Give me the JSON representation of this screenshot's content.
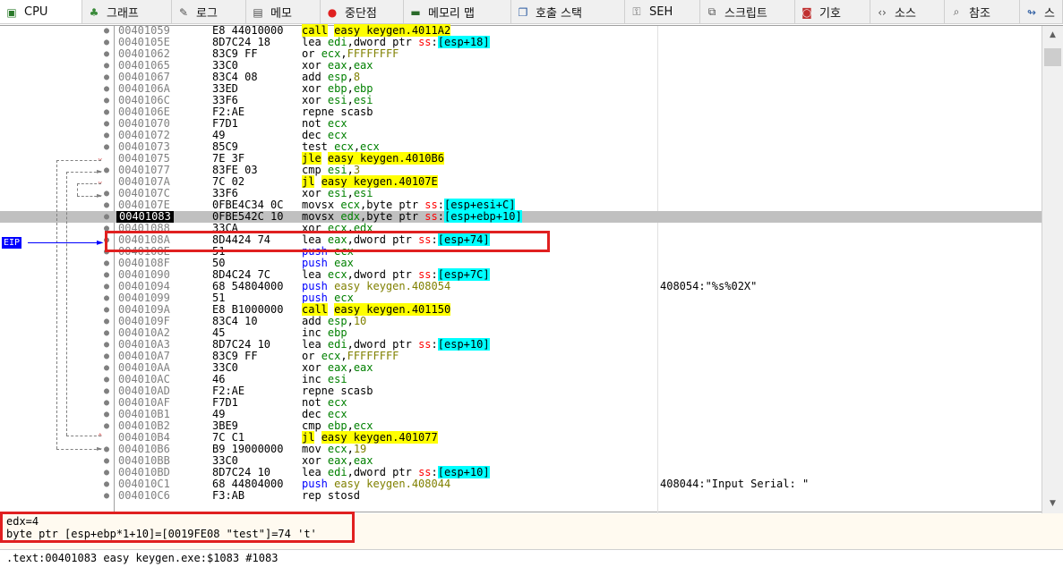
{
  "tabs": [
    {
      "label": "CPU",
      "icon": "cpu-icon",
      "active": true
    },
    {
      "label": "그래프",
      "icon": "graph-icon"
    },
    {
      "label": "로그",
      "icon": "log-icon"
    },
    {
      "label": "메모",
      "icon": "notes-icon"
    },
    {
      "label": "중단점",
      "icon": "breakpoint-icon"
    },
    {
      "label": "메모리 맵",
      "icon": "memory-map-icon"
    },
    {
      "label": "호출 스택",
      "icon": "call-stack-icon"
    },
    {
      "label": "SEH",
      "icon": "seh-icon"
    },
    {
      "label": "스크립트",
      "icon": "script-icon"
    },
    {
      "label": "기호",
      "icon": "symbols-icon"
    },
    {
      "label": "소스",
      "icon": "source-icon"
    },
    {
      "label": "참조",
      "icon": "references-icon"
    },
    {
      "label": "스",
      "icon": "threads-icon"
    }
  ],
  "eip_label": "EIP",
  "colors": {
    "highlight_box": "#e02020",
    "yellow": "#ffff00",
    "cyan": "#00ffff",
    "register": "#008000",
    "segment": "#ff0000"
  },
  "rows": [
    {
      "addr": "00401059",
      "bytes": "E8 44010000",
      "asm": [
        [
          "call",
          "call"
        ],
        [
          "def",
          " "
        ],
        [
          "call",
          "easy keygen.4011A2"
        ]
      ]
    },
    {
      "addr": "0040105E",
      "bytes": "8D7C24 18",
      "asm": [
        [
          "def",
          "lea "
        ],
        [
          "reg",
          "edi"
        ],
        [
          "def",
          ",dword ptr "
        ],
        [
          "seg",
          "ss"
        ],
        [
          "def",
          ":"
        ],
        [
          "mem",
          "[esp+18]"
        ]
      ]
    },
    {
      "addr": "00401062",
      "bytes": "83C9 FF",
      "asm": [
        [
          "def",
          "or "
        ],
        [
          "reg",
          "ecx"
        ],
        [
          "def",
          ","
        ],
        [
          "sym",
          "FFFFFFFF"
        ]
      ]
    },
    {
      "addr": "00401065",
      "bytes": "33C0",
      "asm": [
        [
          "def",
          "xor "
        ],
        [
          "reg",
          "eax"
        ],
        [
          "def",
          ","
        ],
        [
          "reg",
          "eax"
        ]
      ]
    },
    {
      "addr": "00401067",
      "bytes": "83C4 08",
      "asm": [
        [
          "def",
          "add "
        ],
        [
          "reg",
          "esp"
        ],
        [
          "def",
          ","
        ],
        [
          "sym",
          "8"
        ]
      ]
    },
    {
      "addr": "0040106A",
      "bytes": "33ED",
      "asm": [
        [
          "def",
          "xor "
        ],
        [
          "reg",
          "ebp"
        ],
        [
          "def",
          ","
        ],
        [
          "reg",
          "ebp"
        ]
      ]
    },
    {
      "addr": "0040106C",
      "bytes": "33F6",
      "asm": [
        [
          "def",
          "xor "
        ],
        [
          "reg",
          "esi"
        ],
        [
          "def",
          ","
        ],
        [
          "reg",
          "esi"
        ]
      ]
    },
    {
      "addr": "0040106E",
      "bytes": "F2:AE",
      "asm": [
        [
          "def",
          "repne scasb"
        ]
      ]
    },
    {
      "addr": "00401070",
      "bytes": "F7D1",
      "asm": [
        [
          "def",
          "not "
        ],
        [
          "reg",
          "ecx"
        ]
      ]
    },
    {
      "addr": "00401072",
      "bytes": "49",
      "asm": [
        [
          "def",
          "dec "
        ],
        [
          "reg",
          "ecx"
        ]
      ]
    },
    {
      "addr": "00401073",
      "bytes": "85C9",
      "asm": [
        [
          "def",
          "test "
        ],
        [
          "reg",
          "ecx"
        ],
        [
          "def",
          ","
        ],
        [
          "reg",
          "ecx"
        ]
      ]
    },
    {
      "addr": "00401075",
      "bytes": "7E 3F",
      "mark": "dn",
      "asm": [
        [
          "call",
          "jle"
        ],
        [
          "def",
          " "
        ],
        [
          "call",
          "easy keygen.4010B6"
        ]
      ]
    },
    {
      "addr": "00401077",
      "bytes": "83FE 03",
      "asm": [
        [
          "def",
          "cmp "
        ],
        [
          "reg",
          "esi"
        ],
        [
          "def",
          ","
        ],
        [
          "sym",
          "3"
        ]
      ]
    },
    {
      "addr": "0040107A",
      "bytes": "7C 02",
      "mark": "dn",
      "asm": [
        [
          "call",
          "jl"
        ],
        [
          "def",
          " "
        ],
        [
          "call",
          "easy keygen.40107E"
        ]
      ]
    },
    {
      "addr": "0040107C",
      "bytes": "33F6",
      "asm": [
        [
          "def",
          "xor "
        ],
        [
          "reg",
          "esi"
        ],
        [
          "def",
          ","
        ],
        [
          "reg",
          "esi"
        ]
      ]
    },
    {
      "addr": "0040107E",
      "bytes": "0FBE4C34 0C",
      "asm": [
        [
          "def",
          "movsx "
        ],
        [
          "reg",
          "ecx"
        ],
        [
          "def",
          ",byte ptr "
        ],
        [
          "seg",
          "ss"
        ],
        [
          "def",
          ":"
        ],
        [
          "mem",
          "[esp+esi+C]"
        ]
      ]
    },
    {
      "addr": "00401083",
      "bytes": "0FBE542C 10",
      "current": true,
      "asm": [
        [
          "def",
          "movsx "
        ],
        [
          "reg",
          "edx"
        ],
        [
          "def",
          ",byte ptr "
        ],
        [
          "seg",
          "ss"
        ],
        [
          "def",
          ":"
        ],
        [
          "mem",
          "[esp+ebp+10]"
        ]
      ]
    },
    {
      "addr": "00401088",
      "bytes": "33CA",
      "asm": [
        [
          "def",
          "xor "
        ],
        [
          "reg",
          "ecx"
        ],
        [
          "def",
          ","
        ],
        [
          "reg",
          "edx"
        ]
      ]
    },
    {
      "addr": "0040108A",
      "bytes": "8D4424 74",
      "asm": [
        [
          "def",
          "lea "
        ],
        [
          "reg",
          "eax"
        ],
        [
          "def",
          ",dword ptr "
        ],
        [
          "seg",
          "ss"
        ],
        [
          "def",
          ":"
        ],
        [
          "mem",
          "[esp+74]"
        ]
      ]
    },
    {
      "addr": "0040108E",
      "bytes": "51",
      "asm": [
        [
          "push",
          "push "
        ],
        [
          "reg",
          "ecx"
        ]
      ]
    },
    {
      "addr": "0040108F",
      "bytes": "50",
      "asm": [
        [
          "push",
          "push "
        ],
        [
          "reg",
          "eax"
        ]
      ]
    },
    {
      "addr": "00401090",
      "bytes": "8D4C24 7C",
      "asm": [
        [
          "def",
          "lea "
        ],
        [
          "reg",
          "ecx"
        ],
        [
          "def",
          ",dword ptr "
        ],
        [
          "seg",
          "ss"
        ],
        [
          "def",
          ":"
        ],
        [
          "mem",
          "[esp+7C]"
        ]
      ]
    },
    {
      "addr": "00401094",
      "bytes": "68 54804000",
      "cmt": "408054:\"%s%02X\"",
      "asm": [
        [
          "push",
          "push "
        ],
        [
          "sym",
          "easy keygen.408054"
        ]
      ]
    },
    {
      "addr": "00401099",
      "bytes": "51",
      "asm": [
        [
          "push",
          "push "
        ],
        [
          "reg",
          "ecx"
        ]
      ]
    },
    {
      "addr": "0040109A",
      "bytes": "E8 B1000000",
      "asm": [
        [
          "call",
          "call"
        ],
        [
          "def",
          " "
        ],
        [
          "call",
          "easy keygen.401150"
        ]
      ]
    },
    {
      "addr": "0040109F",
      "bytes": "83C4 10",
      "asm": [
        [
          "def",
          "add "
        ],
        [
          "reg",
          "esp"
        ],
        [
          "def",
          ","
        ],
        [
          "sym",
          "10"
        ]
      ]
    },
    {
      "addr": "004010A2",
      "bytes": "45",
      "asm": [
        [
          "def",
          "inc "
        ],
        [
          "reg",
          "ebp"
        ]
      ]
    },
    {
      "addr": "004010A3",
      "bytes": "8D7C24 10",
      "asm": [
        [
          "def",
          "lea "
        ],
        [
          "reg",
          "edi"
        ],
        [
          "def",
          ",dword ptr "
        ],
        [
          "seg",
          "ss"
        ],
        [
          "def",
          ":"
        ],
        [
          "mem",
          "[esp+10]"
        ]
      ]
    },
    {
      "addr": "004010A7",
      "bytes": "83C9 FF",
      "asm": [
        [
          "def",
          "or "
        ],
        [
          "reg",
          "ecx"
        ],
        [
          "def",
          ","
        ],
        [
          "sym",
          "FFFFFFFF"
        ]
      ]
    },
    {
      "addr": "004010AA",
      "bytes": "33C0",
      "asm": [
        [
          "def",
          "xor "
        ],
        [
          "reg",
          "eax"
        ],
        [
          "def",
          ","
        ],
        [
          "reg",
          "eax"
        ]
      ]
    },
    {
      "addr": "004010AC",
      "bytes": "46",
      "asm": [
        [
          "def",
          "inc "
        ],
        [
          "reg",
          "esi"
        ]
      ]
    },
    {
      "addr": "004010AD",
      "bytes": "F2:AE",
      "asm": [
        [
          "def",
          "repne scasb"
        ]
      ]
    },
    {
      "addr": "004010AF",
      "bytes": "F7D1",
      "asm": [
        [
          "def",
          "not "
        ],
        [
          "reg",
          "ecx"
        ]
      ]
    },
    {
      "addr": "004010B1",
      "bytes": "49",
      "asm": [
        [
          "def",
          "dec "
        ],
        [
          "reg",
          "ecx"
        ]
      ]
    },
    {
      "addr": "004010B2",
      "bytes": "3BE9",
      "asm": [
        [
          "def",
          "cmp "
        ],
        [
          "reg",
          "ebp"
        ],
        [
          "def",
          ","
        ],
        [
          "reg",
          "ecx"
        ]
      ]
    },
    {
      "addr": "004010B4",
      "bytes": "7C C1",
      "mark": "up",
      "asm": [
        [
          "call",
          "jl"
        ],
        [
          "def",
          " "
        ],
        [
          "call",
          "easy keygen.401077"
        ]
      ]
    },
    {
      "addr": "004010B6",
      "bytes": "B9 19000000",
      "asm": [
        [
          "def",
          "mov "
        ],
        [
          "reg",
          "ecx"
        ],
        [
          "def",
          ","
        ],
        [
          "sym",
          "19"
        ]
      ]
    },
    {
      "addr": "004010BB",
      "bytes": "33C0",
      "asm": [
        [
          "def",
          "xor "
        ],
        [
          "reg",
          "eax"
        ],
        [
          "def",
          ","
        ],
        [
          "reg",
          "eax"
        ]
      ]
    },
    {
      "addr": "004010BD",
      "bytes": "8D7C24 10",
      "asm": [
        [
          "def",
          "lea "
        ],
        [
          "reg",
          "edi"
        ],
        [
          "def",
          ",dword ptr "
        ],
        [
          "seg",
          "ss"
        ],
        [
          "def",
          ":"
        ],
        [
          "mem",
          "[esp+10]"
        ]
      ]
    },
    {
      "addr": "004010C1",
      "bytes": "68 44804000",
      "cmt": "408044:\"Input Serial: \"",
      "asm": [
        [
          "push",
          "push "
        ],
        [
          "sym",
          "easy keygen.408044"
        ]
      ]
    },
    {
      "addr": "004010C6",
      "bytes": "F3:AB",
      "asm": [
        [
          "def",
          "rep stosd"
        ]
      ]
    }
  ],
  "info": {
    "line1": "edx=4",
    "line2": "byte ptr [esp+ebp*1+10]=[0019FE08 \"test\"]=74 't'"
  },
  "status": ".text:00401083 easy keygen.exe:$1083 #1083"
}
